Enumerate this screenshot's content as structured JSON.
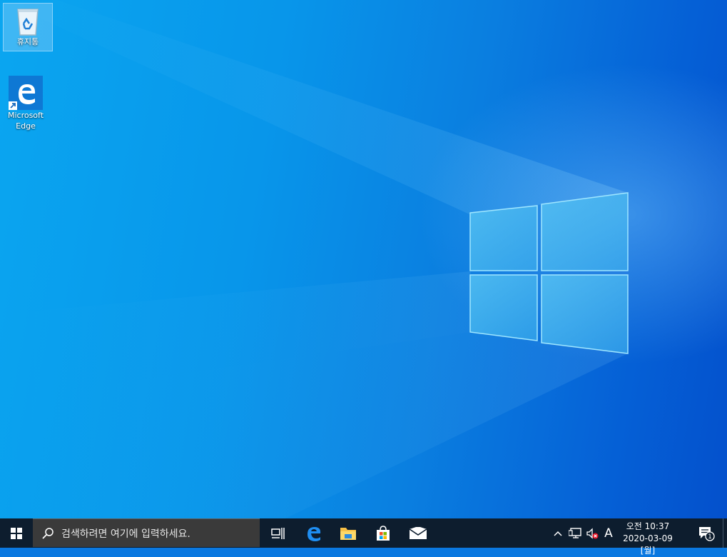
{
  "desktop": {
    "icons": [
      {
        "label": "휴지통",
        "name": "recycle-bin-icon"
      },
      {
        "label_line1": "Microsoft",
        "label_line2": "Edge",
        "name": "edge-icon"
      }
    ]
  },
  "taskbar": {
    "search_placeholder": "검색하려면 여기에 입력하세요.",
    "pinned": [
      "task-view-icon",
      "edge-icon",
      "file-explorer-icon",
      "store-icon",
      "mail-icon"
    ],
    "tray": {
      "input_indicator": "A",
      "time": "오전 10:37",
      "date": "2020-03-09 [월]",
      "notification_count": "1"
    }
  },
  "colors": {
    "taskbar": "#0d1d2e",
    "search_box": "#3a3a3a",
    "accent": "#1e88e5"
  }
}
